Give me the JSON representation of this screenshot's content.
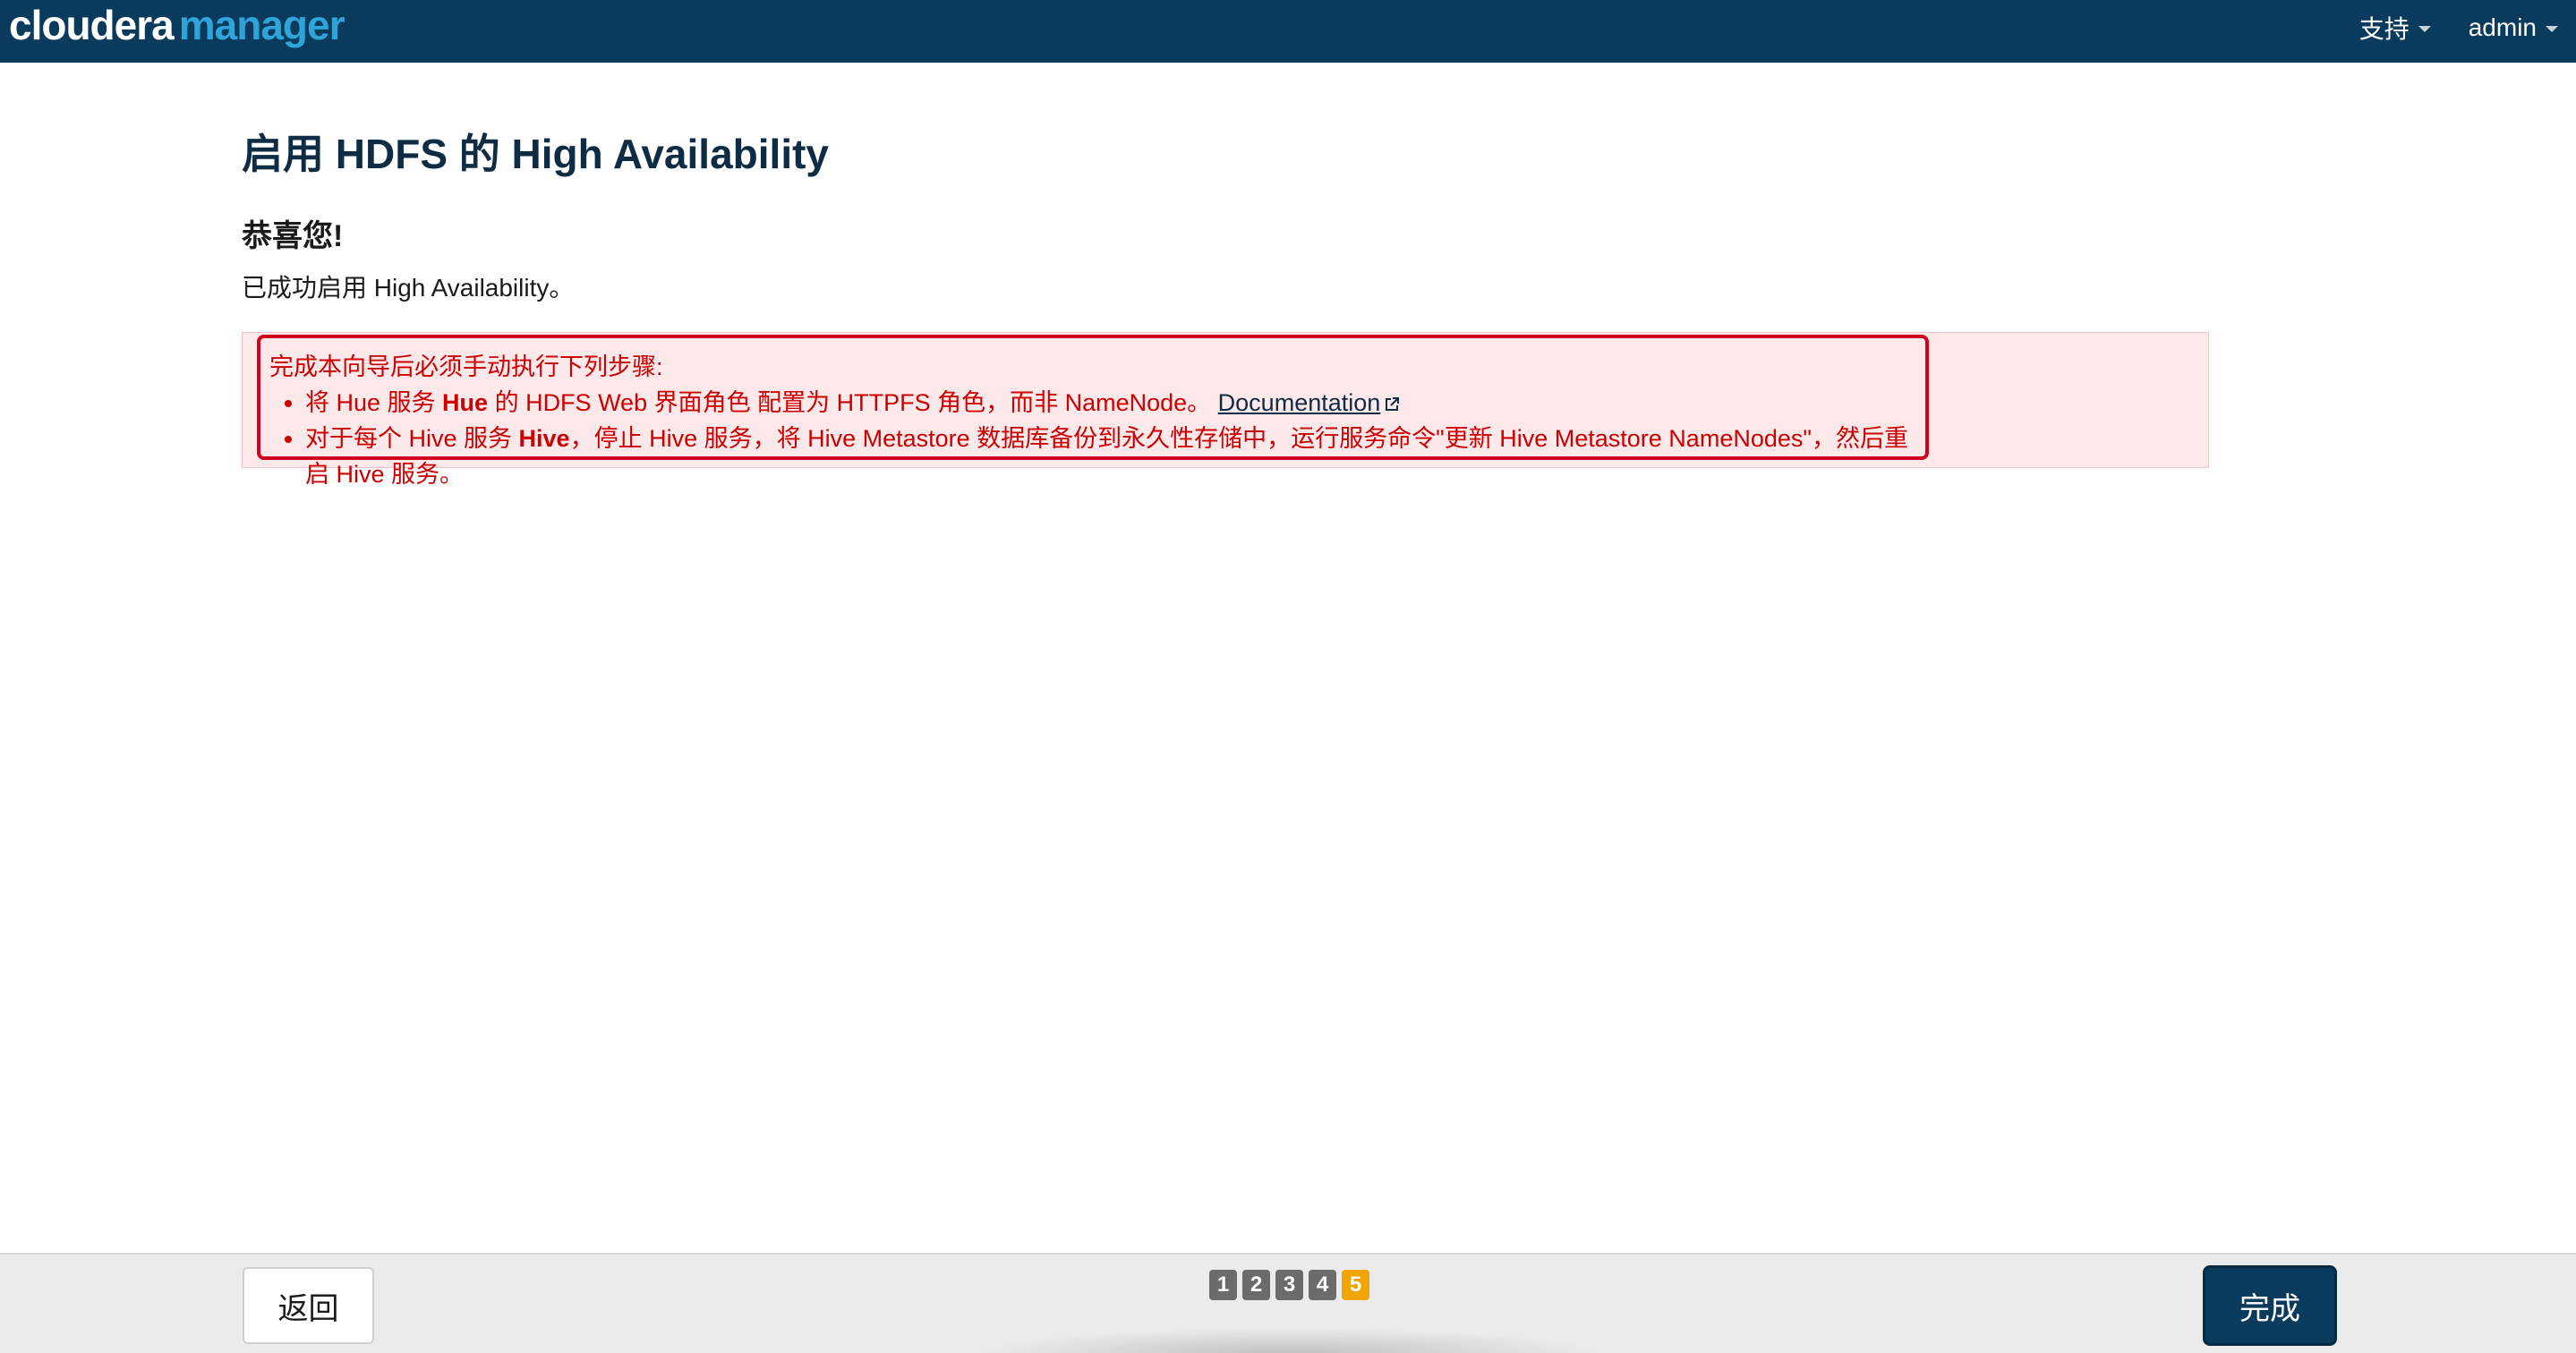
{
  "header": {
    "logo_brand": "cloudera",
    "logo_product": "manager",
    "nav": [
      {
        "label": "支持"
      },
      {
        "label": "admin"
      }
    ]
  },
  "main": {
    "title": "启用 HDFS 的 High Availability",
    "congrats": "恭喜您!",
    "success_text": "已成功启用 High Availability。",
    "alert": {
      "intro": "完成本向导后必须手动执行下列步骤:",
      "item1": {
        "pre": "将 Hue 服务 ",
        "bold": "Hue",
        "post": " 的 HDFS Web 界面角色 配置为 HTTPFS 角色，而非 NameNode。 ",
        "link": "Documentation"
      },
      "item2": {
        "pre": "对于每个 Hive 服务 ",
        "bold": "Hive",
        "post": "，停止 Hive 服务，将 Hive Metastore 数据库备份到永久性存储中，运行服务命令\"更新 Hive Metastore NameNodes\"，然后重启 Hive 服务。"
      }
    }
  },
  "footer": {
    "back_label": "返回",
    "finish_label": "完成",
    "steps": [
      "1",
      "2",
      "3",
      "4",
      "5"
    ],
    "current_step": "5"
  },
  "colors": {
    "topbar": "#0a3a5c",
    "alert_text": "#cc0000",
    "alert_bg": "#fde8ea",
    "active_step": "#f0a500"
  }
}
